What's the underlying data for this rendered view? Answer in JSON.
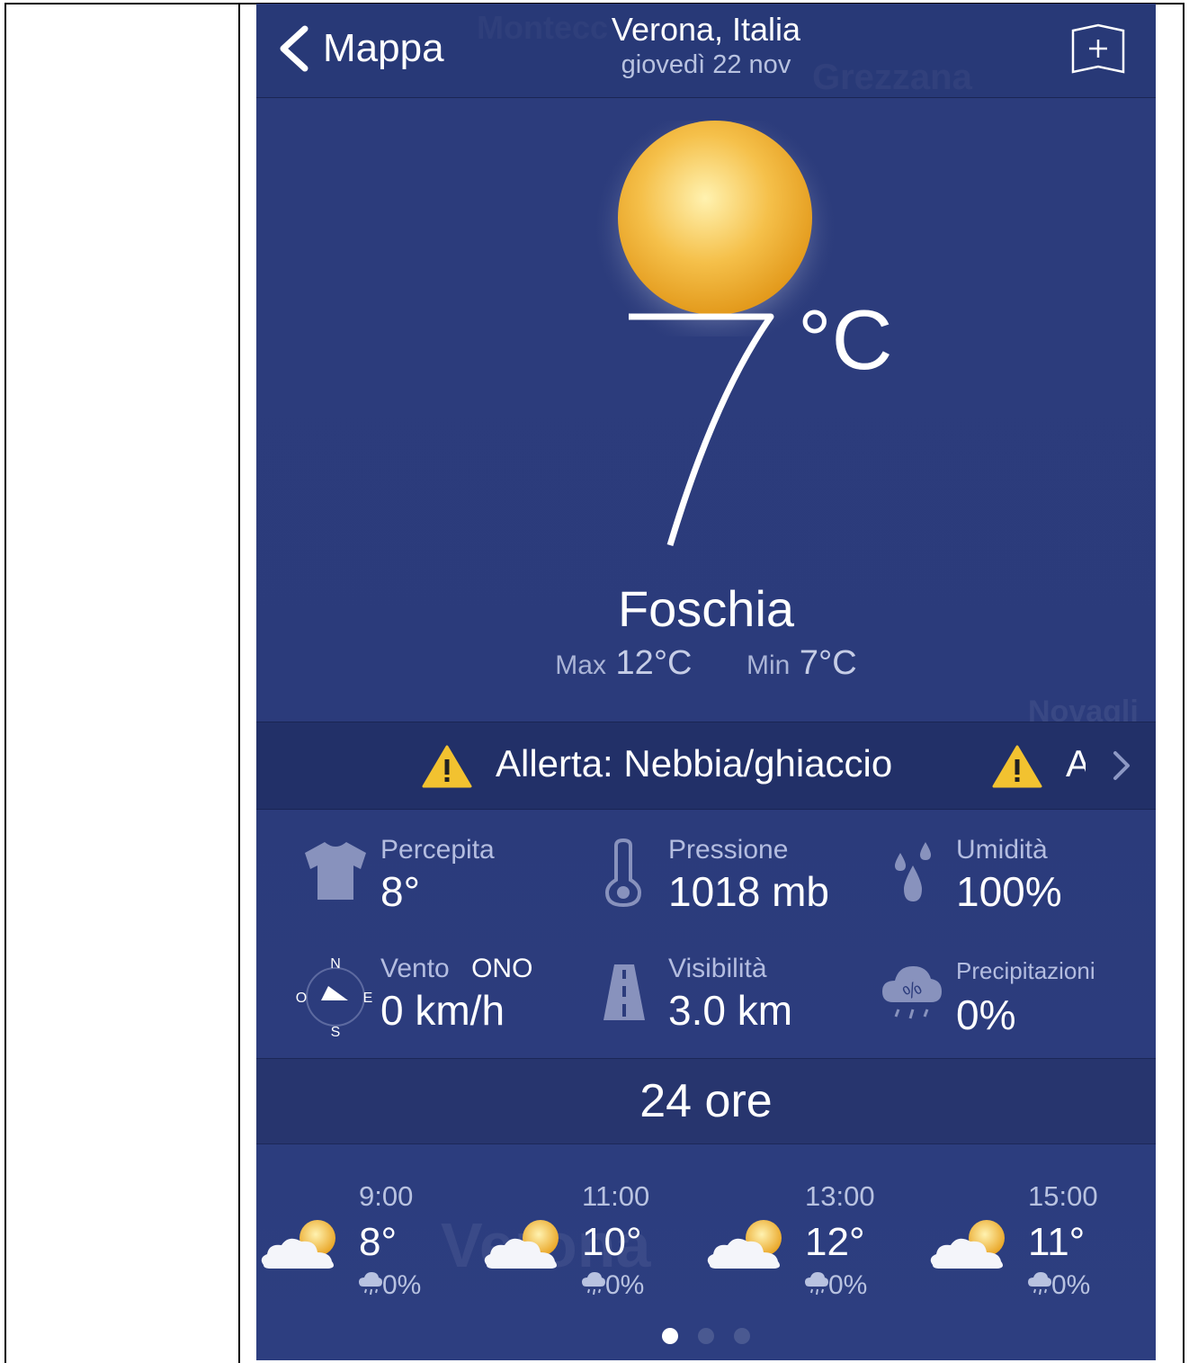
{
  "header": {
    "back_label": "Mappa",
    "location": "Verona, Italia",
    "date": "giovedì 22 nov"
  },
  "map_labels": {
    "a": "Montecc",
    "b": "Grezzana",
    "c": "Novagli",
    "d": "Verona"
  },
  "current": {
    "temperature": "7",
    "unit": "°C",
    "condition": "Foschia",
    "max_label": "Max",
    "max_value": "12°C",
    "min_label": "Min",
    "min_value": "7°C"
  },
  "alert": {
    "text": "Allerta: Nebbia/ghiaccio",
    "text_next": "A"
  },
  "stats": {
    "feels_label": "Percepita",
    "feels_value": "8°",
    "pressure_label": "Pressione",
    "pressure_value": "1018 mb",
    "humidity_label": "Umidità",
    "humidity_value": "100%",
    "wind_label": "Vento",
    "wind_dir": "ONO",
    "wind_value": "0 km/h",
    "visibility_label": "Visibilità",
    "visibility_value": "3.0 km",
    "precip_label": "Precipitazioni",
    "precip_value": "0%",
    "compass": {
      "n": "N",
      "s": "S",
      "e": "E",
      "o": "O"
    }
  },
  "hourly": {
    "title": "24 ore",
    "items": [
      {
        "time": "9:00",
        "temp": "8°",
        "precip": "0%"
      },
      {
        "time": "11:00",
        "temp": "10°",
        "precip": "0%"
      },
      {
        "time": "13:00",
        "temp": "12°",
        "precip": "0%"
      },
      {
        "time": "15:00",
        "temp": "11°",
        "precip": "0%"
      }
    ]
  },
  "pager": {
    "pages": 3,
    "current": 1
  },
  "colors": {
    "background": "#2c3c7c",
    "alert_bar": "#223068",
    "warning": "#f2c230",
    "sun": "#f5c04a"
  },
  "icons": [
    "chevron-left-icon",
    "add-bookmark-icon",
    "sun-icon",
    "warning-icon",
    "shirt-icon",
    "thermometer-icon",
    "drops-icon",
    "compass-icon",
    "road-icon",
    "rain-percent-icon",
    "partly-cloudy-icon",
    "rain-drop-icon"
  ]
}
